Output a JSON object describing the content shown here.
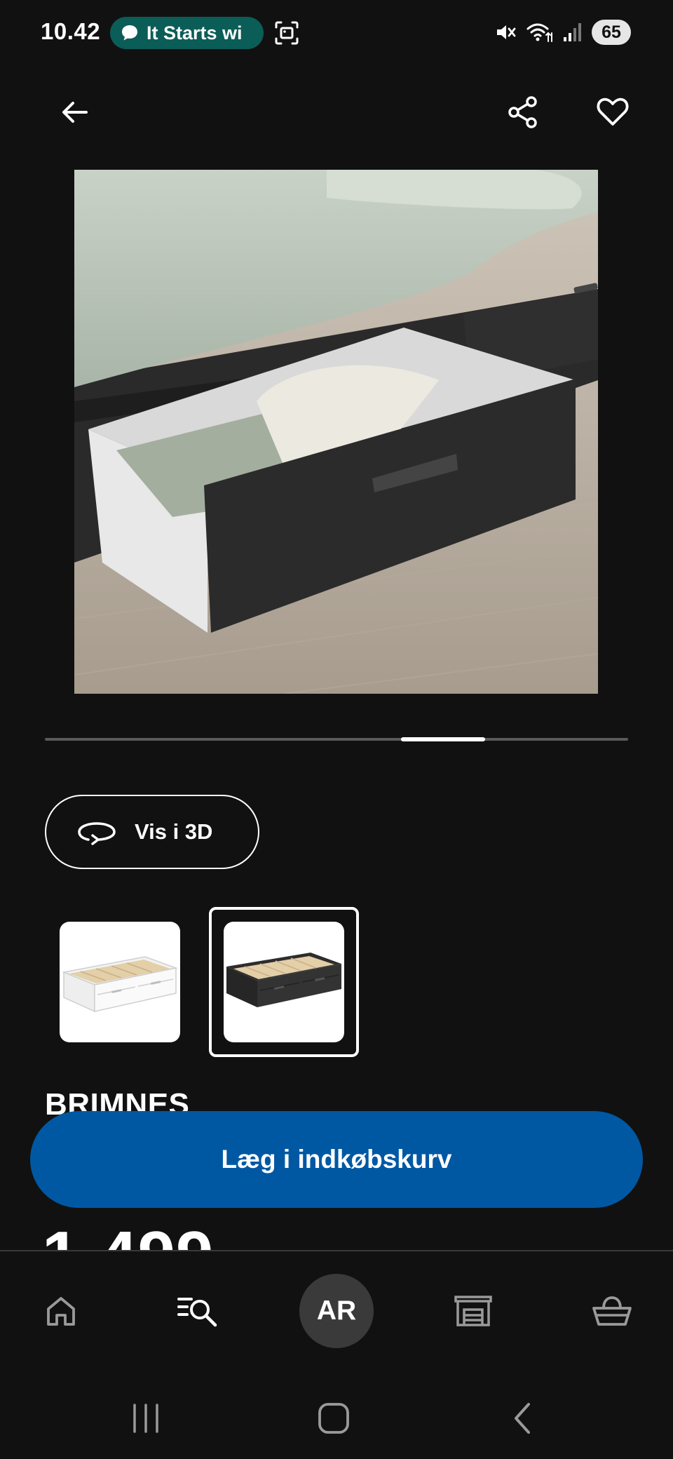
{
  "status_bar": {
    "time": "10.42",
    "media_pill_text": "It Starts wi",
    "battery": "65",
    "pill_color": "#0b5d57"
  },
  "top_bar": {
    "back_icon": "arrow-left-icon",
    "share_icon": "share-icon",
    "favorite_icon": "heart-outline-icon"
  },
  "carousel": {
    "progress_fraction": 0.714
  },
  "view_3d": {
    "label": "Vis i 3D",
    "icon": "rotate-3d-icon"
  },
  "variants": [
    {
      "name": "white",
      "selected": false
    },
    {
      "name": "black",
      "selected": true
    }
  ],
  "product": {
    "name": "BRIMNES",
    "price": "1.499,-"
  },
  "cta": {
    "label": "Læg i indkøbskurv",
    "color": "#0058a3"
  },
  "bottom_nav": {
    "ar_label": "AR",
    "items": [
      "home-icon",
      "search-list-icon",
      "ar-button",
      "store-icon",
      "basket-icon"
    ]
  }
}
